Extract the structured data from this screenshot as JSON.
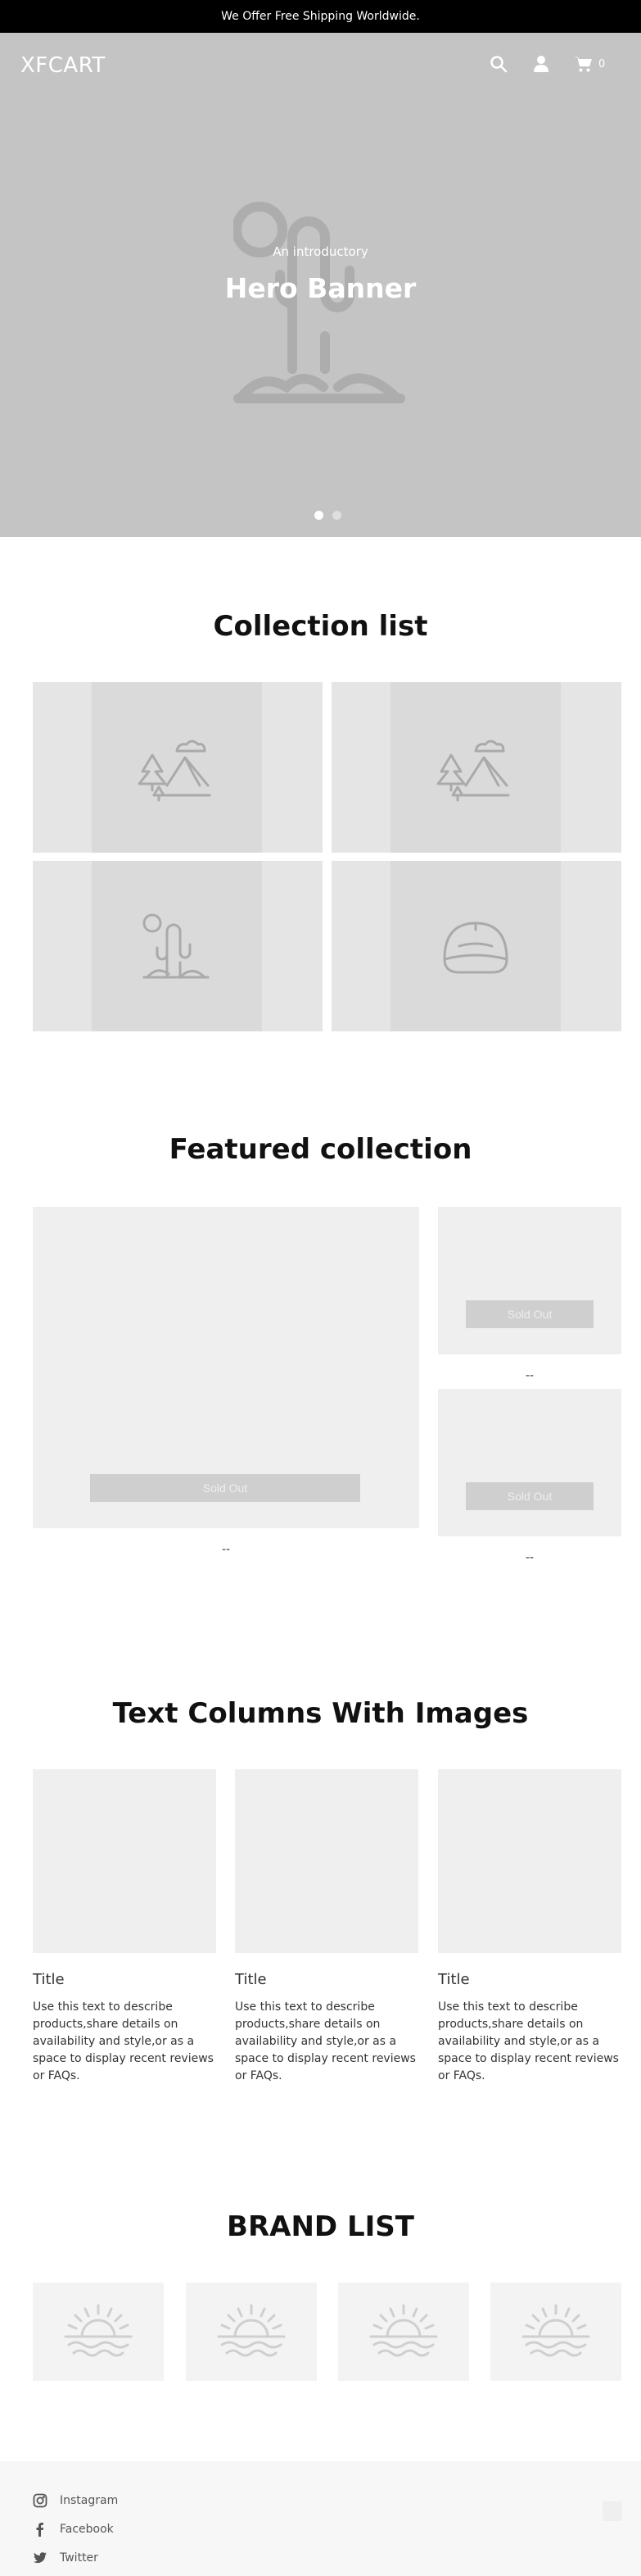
{
  "announcement": {
    "text": "We Offer Free Shipping Worldwide."
  },
  "header": {
    "logo": "XFCART",
    "cart_count": "0",
    "icons": [
      "search-icon",
      "account-icon",
      "cart-icon"
    ]
  },
  "hero": {
    "subtitle": "An introductory",
    "title": "Hero Banner",
    "slides": 2,
    "active_slide": 1
  },
  "collection_list": {
    "title": "Collection list",
    "items": [
      {
        "icon": "mountain-landscape-icon"
      },
      {
        "icon": "mountain-landscape-icon"
      },
      {
        "icon": "cactus-icon"
      },
      {
        "icon": "cap-icon"
      }
    ]
  },
  "featured_collection": {
    "title": "Featured collection",
    "products": [
      {
        "button": "Sold Out",
        "price": "--"
      },
      {
        "button": "Sold Out",
        "price": "--"
      },
      {
        "button": "Sold Out",
        "price": "--"
      }
    ]
  },
  "text_columns": {
    "title": "Text Columns With Images",
    "columns": [
      {
        "title": "Title",
        "text": "Use this text to describe products,share details on availability and style,or as a space to display recent reviews or FAQs."
      },
      {
        "title": "Title",
        "text": "Use this text to describe products,share details on availability and style,or as a space to display recent reviews or FAQs."
      },
      {
        "title": "Title",
        "text": "Use this text to describe products,share details on availability and style,or as a space to display recent reviews or FAQs."
      }
    ]
  },
  "brand_list": {
    "title": "BRAND LIST",
    "items": [
      {
        "icon": "sunrise-icon"
      },
      {
        "icon": "sunrise-icon"
      },
      {
        "icon": "sunrise-icon"
      },
      {
        "icon": "sunrise-icon"
      }
    ]
  },
  "footer": {
    "social": [
      {
        "label": "Instagram",
        "icon": "instagram-icon"
      },
      {
        "label": "Facebook",
        "icon": "facebook-icon"
      },
      {
        "label": "Twitter",
        "icon": "twitter-icon"
      }
    ]
  },
  "colors": {
    "announcement_bg": "#000000",
    "hero_bg": "#c4c4c4",
    "placeholder_bg": "#efefef",
    "footer_bg": "#f7f7f7"
  }
}
